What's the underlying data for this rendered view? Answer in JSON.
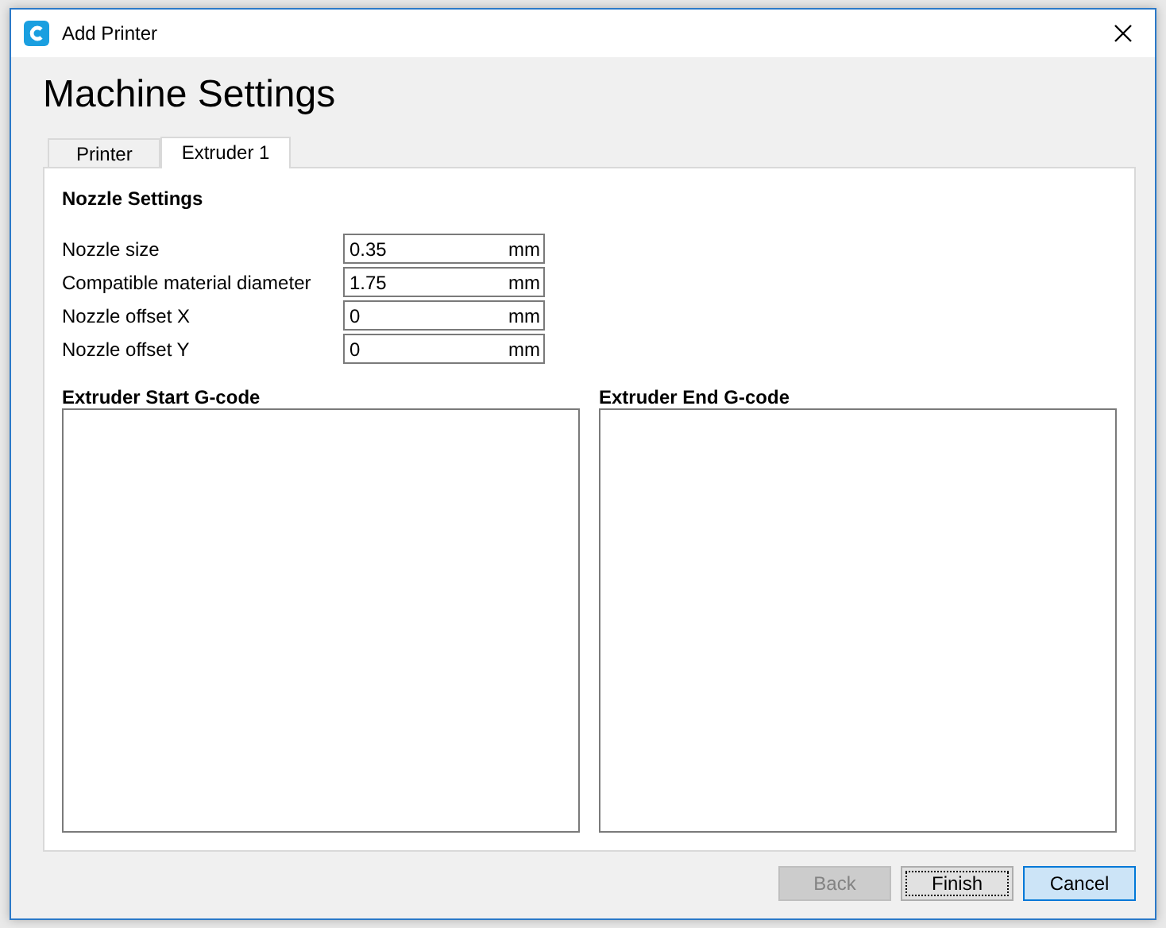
{
  "window": {
    "title": "Add Printer"
  },
  "heading": "Machine Settings",
  "tabs": [
    {
      "label": "Printer",
      "selected": false
    },
    {
      "label": "Extruder 1",
      "selected": true
    }
  ],
  "nozzle_settings": {
    "title": "Nozzle Settings",
    "fields": [
      {
        "label": "Nozzle size",
        "value": "0.35",
        "unit": "mm"
      },
      {
        "label": "Compatible material diameter",
        "value": "1.75",
        "unit": "mm"
      },
      {
        "label": "Nozzle offset X",
        "value": "0",
        "unit": "mm"
      },
      {
        "label": "Nozzle offset Y",
        "value": "0",
        "unit": "mm"
      }
    ]
  },
  "gcode": [
    {
      "title": "Extruder Start G-code"
    },
    {
      "title": "Extruder End G-code"
    }
  ],
  "buttons": [
    {
      "label": "Back",
      "disabled": true,
      "focused": false,
      "default": false
    },
    {
      "label": "Finish",
      "disabled": false,
      "focused": true,
      "default": false
    },
    {
      "label": "Cancel",
      "disabled": false,
      "focused": false,
      "default": true
    }
  ]
}
